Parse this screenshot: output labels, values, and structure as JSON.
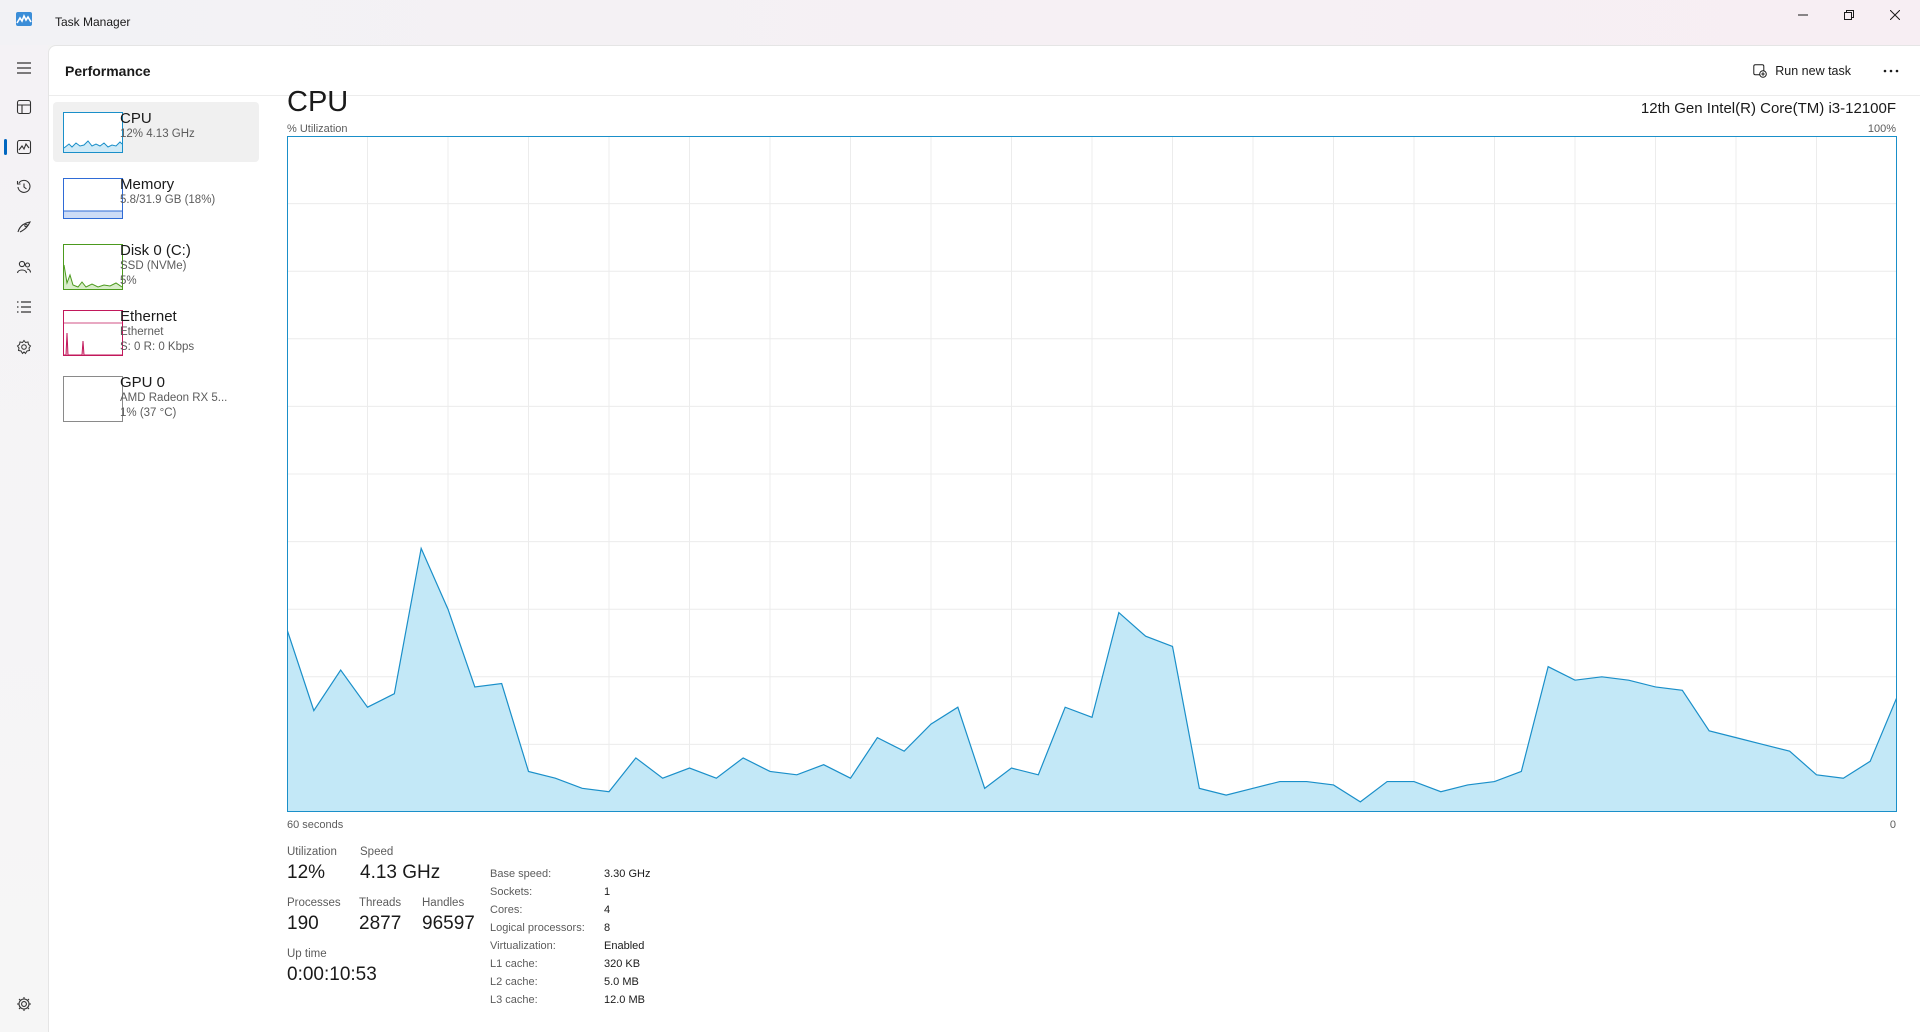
{
  "app": {
    "title": "Task Manager"
  },
  "header": {
    "page_title": "Performance",
    "run_new_task": "Run new task"
  },
  "nav": {
    "items": [
      "menu-icon",
      "processes-icon",
      "performance-icon",
      "app-history-icon",
      "startup-apps-icon",
      "users-icon",
      "details-icon",
      "services-icon",
      "settings-icon"
    ],
    "selected": "performance-icon"
  },
  "perf_list": [
    {
      "name": "CPU",
      "sub1": "12% 4.13 GHz",
      "sub2": "",
      "color": "#1a8fc9",
      "fill": "#cfeaf7"
    },
    {
      "name": "Memory",
      "sub1": "5.8/31.9 GB (18%)",
      "sub2": "",
      "color": "#2f6bd6",
      "fill": "#cddcf6"
    },
    {
      "name": "Disk 0 (C:)",
      "sub1": "SSD (NVMe)",
      "sub2": "5%",
      "color": "#4c9a1e",
      "fill": "#d8edc9"
    },
    {
      "name": "Ethernet",
      "sub1": "Ethernet",
      "sub2": "S: 0 R: 0 Kbps",
      "color": "#c2185b",
      "fill": "#f5d0de"
    },
    {
      "name": "GPU 0",
      "sub1": "AMD Radeon RX 5...",
      "sub2": "1% (37 °C)",
      "color": "#7a4fc9",
      "fill": "#e6ddf6"
    }
  ],
  "cpu": {
    "title": "CPU",
    "model": "12th Gen Intel(R) Core(TM) i3-12100F",
    "util_label": "% Utilization",
    "util_max": "100%",
    "time_left": "60 seconds",
    "time_right": "0"
  },
  "stats": {
    "utilization_label": "Utilization",
    "utilization": "12%",
    "speed_label": "Speed",
    "speed": "4.13 GHz",
    "processes_label": "Processes",
    "processes": "190",
    "threads_label": "Threads",
    "threads": "2877",
    "handles_label": "Handles",
    "handles": "96597",
    "uptime_label": "Up time",
    "uptime": "0:00:10:53"
  },
  "specs": [
    {
      "k": "Base speed:",
      "v": "3.30 GHz"
    },
    {
      "k": "Sockets:",
      "v": "1"
    },
    {
      "k": "Cores:",
      "v": "4"
    },
    {
      "k": "Logical processors:",
      "v": "8"
    },
    {
      "k": "Virtualization:",
      "v": "Enabled"
    },
    {
      "k": "L1 cache:",
      "v": "320 KB"
    },
    {
      "k": "L2 cache:",
      "v": "5.0 MB"
    },
    {
      "k": "L3 cache:",
      "v": "12.0 MB"
    }
  ],
  "chart_data": {
    "type": "area",
    "title": "CPU",
    "ylabel": "% Utilization",
    "xlabel": "60 seconds",
    "ylim": [
      0,
      100
    ],
    "xlim": [
      60,
      0
    ],
    "grid": true,
    "stroke": "#1a8fc9",
    "fill": "#c3e8f7",
    "x": [
      60,
      59,
      58,
      57,
      56,
      55,
      54,
      53,
      52,
      51,
      50,
      49,
      48,
      47,
      46,
      45,
      44,
      43,
      42,
      41,
      40,
      39,
      38,
      37,
      36,
      35,
      34,
      33,
      32,
      31,
      30,
      29,
      28,
      27,
      26,
      25,
      24,
      23,
      22,
      21,
      20,
      19,
      18,
      17,
      16,
      15,
      14,
      13,
      12,
      11,
      10,
      9,
      8,
      7,
      6,
      5,
      4,
      3,
      2,
      1,
      0
    ],
    "values": [
      27,
      15,
      21,
      15.5,
      17.5,
      39,
      30,
      18.5,
      19,
      6,
      5,
      3.5,
      3,
      8,
      5,
      6.5,
      5,
      8,
      6,
      5.5,
      7,
      5,
      11,
      9,
      13,
      15.5,
      3.5,
      6.5,
      5.5,
      15.5,
      14,
      29.5,
      26,
      24.5,
      3.5,
      2.5,
      3.5,
      4.5,
      4.5,
      4,
      1.5,
      4.5,
      4.5,
      3,
      4,
      4.5,
      6,
      21.5,
      19.5,
      20,
      19.5,
      18.5,
      18,
      12,
      11,
      10,
      9,
      5.5,
      5,
      7.5,
      17
    ]
  }
}
